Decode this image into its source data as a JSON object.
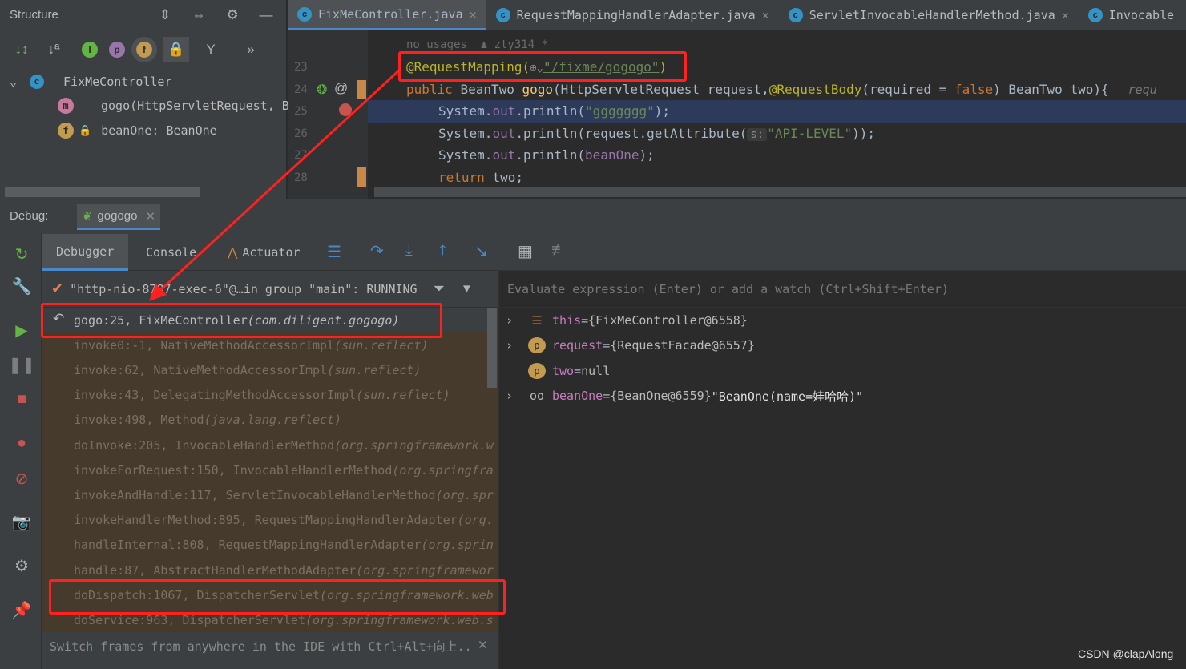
{
  "structure": {
    "title": "Structure",
    "class_name": "FixMeController",
    "members": [
      {
        "badge": "m",
        "text": "gogo(HttpServletRequest, B"
      },
      {
        "badge": "f",
        "text": "beanOne: BeanOne"
      }
    ]
  },
  "editor": {
    "tabs": [
      {
        "label": "FixMeController.java",
        "active": true
      },
      {
        "label": "RequestMappingHandlerAdapter.java"
      },
      {
        "label": "ServletInvocableHandlerMethod.java"
      },
      {
        "label": "Invocable"
      }
    ],
    "usages_hint": "no usages  ♟ zty314 *",
    "line_numbers": [
      "23",
      "24",
      "25",
      "26",
      "27",
      "28"
    ],
    "l23": {
      "ann": "@RequestMapping(",
      "path": "\"/fixme/gogogo\"",
      "close": ")"
    },
    "l24": {
      "kw": "public ",
      "type": "BeanTwo ",
      "fn": "gogo",
      "p1": "(HttpServletRequest request,",
      "ann": "@RequestBody",
      "p2": "(required = ",
      "kw2": "false",
      "p3": ") BeanTwo two){",
      "hint": "requ"
    },
    "l25": {
      "obj": "System.",
      "fld": "out",
      "call": ".println(",
      "str": "\"ggggggg\"",
      "end": ");"
    },
    "l26": {
      "obj": "System.",
      "fld": "out",
      "call": ".println(request.getAttribute(",
      "hint": "s:",
      "str": "\"API-LEVEL\"",
      "end": "));"
    },
    "l27": {
      "obj": "System.",
      "fld": "out",
      "call": ".println(",
      "fld2": "beanOne",
      "end": ");"
    },
    "l28": {
      "kw": "return ",
      "rest": "two;"
    }
  },
  "debug": {
    "label": "Debug:",
    "session": "gogogo",
    "tabs": {
      "debugger": "Debugger",
      "console": "Console",
      "actuator": "Actuator"
    },
    "thread": "\"http-nio-8787-exec-6\"@…in group \"main\": RUNNING",
    "evaluate_placeholder": "Evaluate expression (Enter) or add a watch (Ctrl+Shift+Enter)",
    "frames": [
      {
        "loc": "gogo:25, FixMeController ",
        "pkg": "(com.diligent.gogogo)",
        "current": true
      },
      {
        "loc": "invoke0:-1, NativeMethodAccessorImpl ",
        "pkg": "(sun.reflect)"
      },
      {
        "loc": "invoke:62, NativeMethodAccessorImpl ",
        "pkg": "(sun.reflect)"
      },
      {
        "loc": "invoke:43, DelegatingMethodAccessorImpl ",
        "pkg": "(sun.reflect)"
      },
      {
        "loc": "invoke:498, Method ",
        "pkg": "(java.lang.reflect)"
      },
      {
        "loc": "doInvoke:205, InvocableHandlerMethod ",
        "pkg": "(org.springframework.w"
      },
      {
        "loc": "invokeForRequest:150, InvocableHandlerMethod ",
        "pkg": "(org.springfra"
      },
      {
        "loc": "invokeAndHandle:117, ServletInvocableHandlerMethod ",
        "pkg": "(org.spr"
      },
      {
        "loc": "invokeHandlerMethod:895, RequestMappingHandlerAdapter ",
        "pkg": "(org."
      },
      {
        "loc": "handleInternal:808, RequestMappingHandlerAdapter ",
        "pkg": "(org.sprin"
      },
      {
        "loc": "handle:87, AbstractHandlerMethodAdapter ",
        "pkg": "(org.springframewor"
      },
      {
        "loc": "doDispatch:1067, DispatcherServlet ",
        "pkg": "(org.springframework.web"
      },
      {
        "loc": "doService:963, DispatcherServlet ",
        "pkg": "(org.springframework.web.s"
      }
    ],
    "tip": "Switch frames from anywhere in the IDE with Ctrl+Alt+向上..",
    "variables": [
      {
        "name": "this",
        "eq": " = ",
        "value": "{FixMeController@6558}",
        "extra": "",
        "expandable": true,
        "icon": "bars"
      },
      {
        "name": "request",
        "eq": " = ",
        "value": "{RequestFacade@6557}",
        "extra": "",
        "expandable": true,
        "icon": "p"
      },
      {
        "name": "two",
        "eq": " = ",
        "value": "null",
        "extra": "",
        "expandable": false,
        "icon": "p"
      },
      {
        "name": "beanOne",
        "eq": " = ",
        "value": "{BeanOne@6559}",
        "extra": " \"BeanOne(name=娃哈哈)\"",
        "expandable": true,
        "icon": "glasses"
      }
    ]
  },
  "watermark": "CSDN @clapAlong",
  "colors": {
    "annotation_box": "#ff2020",
    "current_line": "#2d3a5a"
  }
}
